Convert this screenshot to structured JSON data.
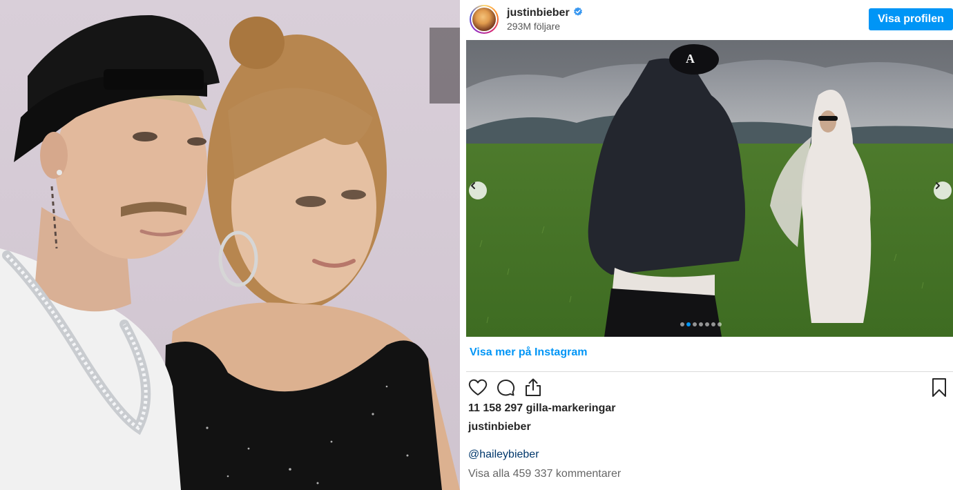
{
  "left_photo": {
    "alt_subject": "couple-red-carpet-photo"
  },
  "embed": {
    "username": "justinbieber",
    "verified": true,
    "followers": "293M följare",
    "profile_button": "Visa profilen",
    "carousel": {
      "slide_count": 7,
      "active_index": 1
    },
    "more_link": "Visa mer på Instagram",
    "likes": "11 158 297 gilla-markeringar",
    "caption_user": "justinbieber",
    "caption_mention": "@haileybieber",
    "comments_link": "Visa alla 459 337 kommentarer",
    "icons": [
      "heart-icon",
      "comment-icon",
      "share-icon",
      "bookmark-icon",
      "chevron-left-icon",
      "chevron-right-icon",
      "verified-badge-icon"
    ]
  },
  "colors": {
    "accent": "#0095f6",
    "mention": "#00376b",
    "divider": "#dbdbdb",
    "text": "#262626"
  }
}
